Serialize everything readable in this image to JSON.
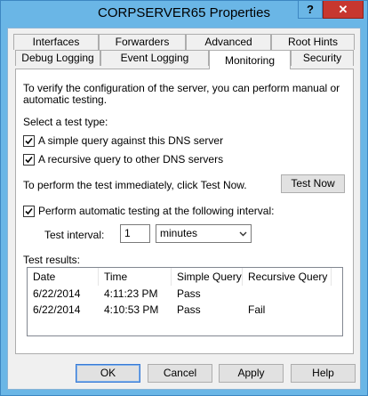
{
  "window": {
    "title": "CORPSERVER65 Properties",
    "help_glyph": "?",
    "close_glyph": "✕"
  },
  "tabs": {
    "row1": [
      "Interfaces",
      "Forwarders",
      "Advanced",
      "Root Hints"
    ],
    "row2": [
      "Debug Logging",
      "Event Logging",
      "Monitoring",
      "Security"
    ],
    "active": "Monitoring"
  },
  "monitoring": {
    "intro_line1": "To verify the configuration of the server, you can perform manual or",
    "intro_line2": "automatic testing.",
    "select_type_label": "Select a test type:",
    "simple_query_label": "A simple query against this DNS server",
    "simple_query_checked": true,
    "recursive_query_label": "A recursive query to other DNS servers",
    "recursive_query_checked": true,
    "test_now_hint": "To perform the test immediately, click Test Now.",
    "test_now_button": "Test Now",
    "auto_test_label": "Perform automatic testing at the following interval:",
    "auto_test_checked": true,
    "test_interval_label": "Test interval:",
    "test_interval_value": "1",
    "interval_unit": "minutes",
    "results_label": "Test results:",
    "columns": [
      "Date",
      "Time",
      "Simple Query",
      "Recursive Query"
    ],
    "rows": [
      {
        "date": "6/22/2014",
        "time": "4:11:23 PM",
        "simple": "Pass",
        "recursive": ""
      },
      {
        "date": "6/22/2014",
        "time": "4:10:53 PM",
        "simple": "Pass",
        "recursive": "Fail"
      }
    ]
  },
  "buttons": {
    "ok": "OK",
    "cancel": "Cancel",
    "apply": "Apply",
    "help": "Help"
  }
}
